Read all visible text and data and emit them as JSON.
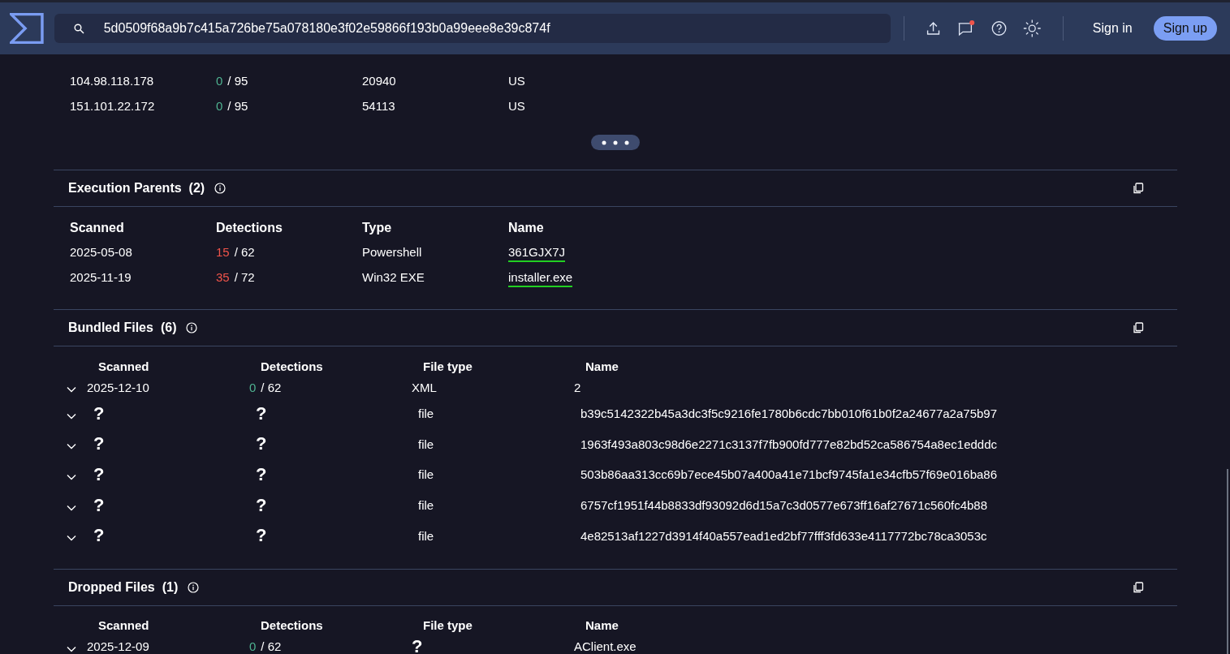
{
  "header": {
    "search": {
      "value": "5d0509f68a9b7c415a726be75a078180e3f02e59866f193b0a99eee8e39c874f"
    },
    "sign_in": "Sign in",
    "sign_up": "Sign up"
  },
  "network_table": {
    "rows": [
      {
        "ip": "104.98.118.178",
        "positives": "0",
        "total": "/ 95",
        "flagged": false,
        "asn": "20940",
        "country": "US"
      },
      {
        "ip": "151.101.22.172",
        "positives": "0",
        "total": "/ 95",
        "flagged": false,
        "asn": "54113",
        "country": "US"
      }
    ]
  },
  "execution_parents": {
    "title": "Execution Parents",
    "count": "(2)",
    "columns": [
      "Scanned",
      "Detections",
      "Type",
      "Name"
    ],
    "rows": [
      {
        "scanned": "2025-05-08",
        "positives": "15",
        "total": "/ 62",
        "flagged": true,
        "type": "Powershell",
        "name": "361GJX7J"
      },
      {
        "scanned": "2025-11-19",
        "positives": "35",
        "total": "/ 72",
        "flagged": true,
        "type": "Win32 EXE",
        "name": "installer.exe"
      }
    ]
  },
  "file_sections": [
    {
      "title": "Bundled Files",
      "count": "(6)",
      "columns": [
        "Scanned",
        "Detections",
        "File type",
        "Name"
      ],
      "rows": [
        {
          "kind": "scanned",
          "scanned": "2025-12-10",
          "positives": "0",
          "total": "/ 62",
          "flagged": false,
          "file_type": "XML",
          "name": "2"
        },
        {
          "kind": "unknown",
          "scanned": "?",
          "detections": "?",
          "file_type": "file",
          "name": "b39c5142322b45a3dc3f5c9216fe1780b6cdc7bb010f61b0f2a24677a2a75b97"
        },
        {
          "kind": "unknown",
          "scanned": "?",
          "detections": "?",
          "file_type": "file",
          "name": "1963f493a803c98d6e2271c3137f7fb900fd777e82bd52ca586754a8ec1edddc"
        },
        {
          "kind": "unknown",
          "scanned": "?",
          "detections": "?",
          "file_type": "file",
          "name": "503b86aa313cc69b7ece45b07a400a41e71bcf9745fa1e34cfb57f69e016ba86"
        },
        {
          "kind": "unknown",
          "scanned": "?",
          "detections": "?",
          "file_type": "file",
          "name": "6757cf1951f44b8833df93092d6d15a7c3d0577e673ff16af27671c560fc4b88"
        },
        {
          "kind": "unknown",
          "scanned": "?",
          "detections": "?",
          "file_type": "file",
          "name": "4e82513af1227d3914f40a557ead1ed2bf77fff3fd633e4117772bc78ca3053c"
        }
      ]
    },
    {
      "title": "Dropped Files",
      "count": "(1)",
      "columns": [
        "Scanned",
        "Detections",
        "File type",
        "Name"
      ],
      "rows": [
        {
          "kind": "scanned",
          "scanned": "2025-12-09",
          "positives": "0",
          "total": "/ 62",
          "flagged": false,
          "file_type": "?",
          "name": "AClient.exe"
        }
      ]
    }
  ]
}
